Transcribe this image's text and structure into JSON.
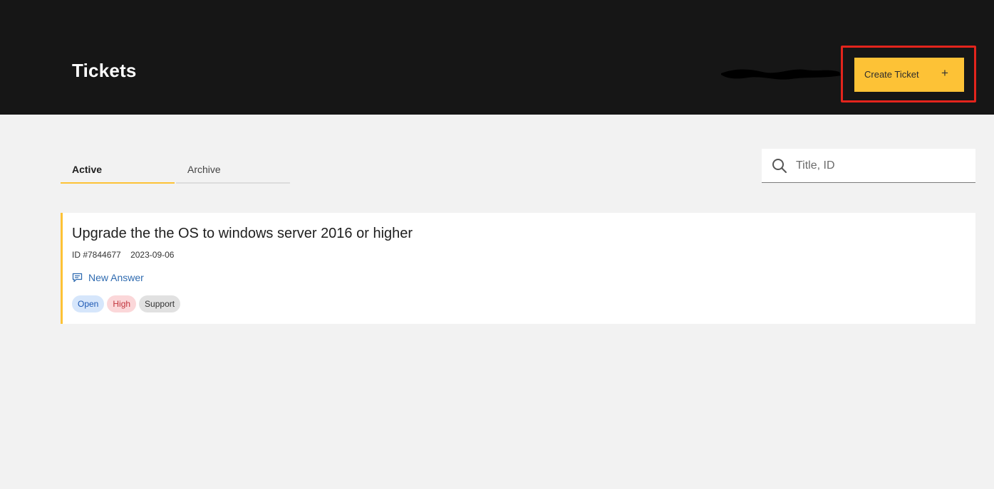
{
  "header": {
    "title": "Tickets",
    "create_button_label": "Create Ticket",
    "create_button_icon": "plus-icon",
    "plus_glyph": "+"
  },
  "tabs": [
    {
      "label": "Active",
      "active": true
    },
    {
      "label": "Archive",
      "active": false
    }
  ],
  "search": {
    "placeholder": "Title, ID",
    "value": "",
    "icon": "search-icon"
  },
  "tickets": [
    {
      "title": "Upgrade the the OS to windows server 2016 or higher",
      "id": "ID #7844677",
      "date": "2023-09-06",
      "answer_label": "New Answer",
      "answer_icon": "comment-icon",
      "tags": {
        "status": "Open",
        "priority": "High",
        "category": "Support"
      }
    }
  ],
  "colors": {
    "header_bg": "#161616",
    "accent": "#fdc236",
    "highlight": "#e3241c",
    "link": "#2f6bb0"
  }
}
